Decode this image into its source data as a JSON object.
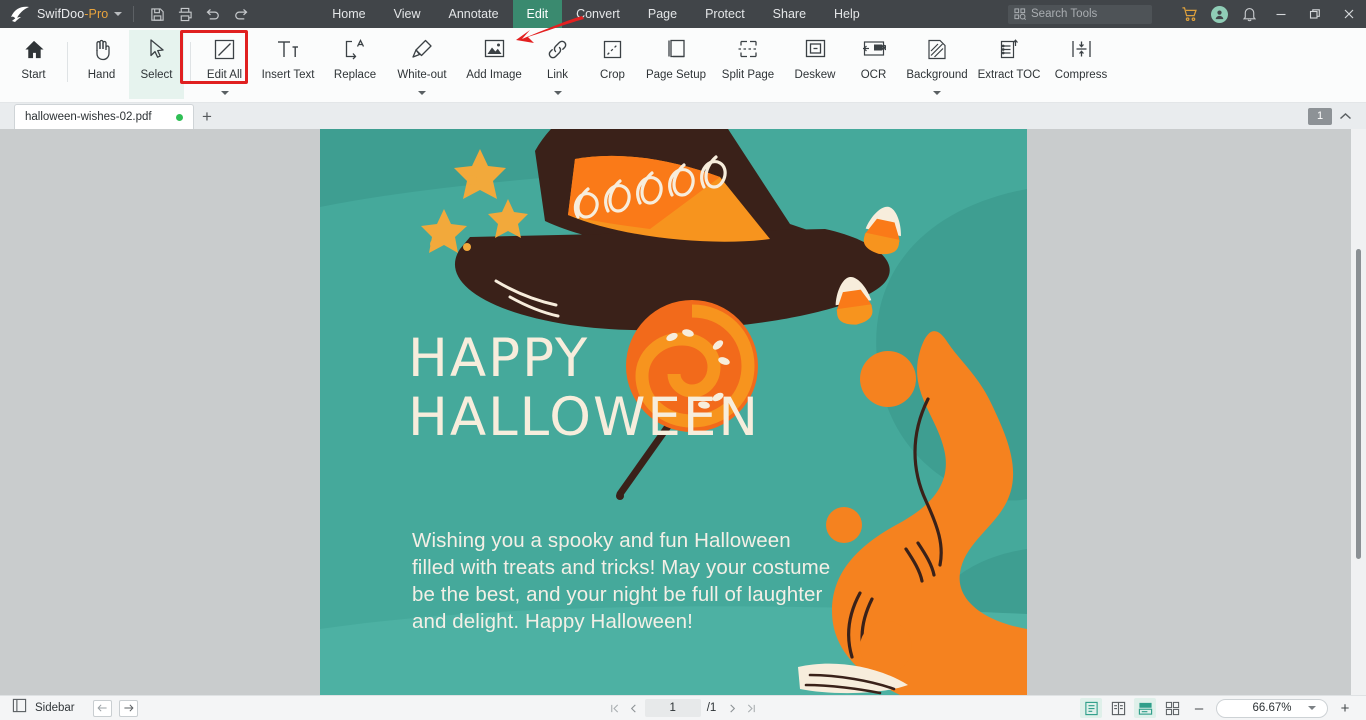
{
  "titlebar": {
    "brand": "SwifDoo",
    "brand_suffix": "-Pro",
    "quick_actions": [
      {
        "name": "save-icon",
        "label": "Save"
      },
      {
        "name": "print-icon",
        "label": "Print"
      },
      {
        "name": "undo-icon",
        "label": "Undo"
      },
      {
        "name": "redo-icon",
        "label": "Redo"
      }
    ],
    "menus": [
      {
        "label": "Home",
        "active": false
      },
      {
        "label": "View",
        "active": false
      },
      {
        "label": "Annotate",
        "active": false
      },
      {
        "label": "Edit",
        "active": true
      },
      {
        "label": "Convert",
        "active": false
      },
      {
        "label": "Page",
        "active": false
      },
      {
        "label": "Protect",
        "active": false
      },
      {
        "label": "Share",
        "active": false
      },
      {
        "label": "Help",
        "active": false
      }
    ],
    "search_placeholder": "Search Tools",
    "right_icons": [
      {
        "name": "cart-icon",
        "label": "Store"
      },
      {
        "name": "account-icon",
        "label": "Account"
      },
      {
        "name": "bell-icon",
        "label": "Notifications"
      }
    ],
    "window_buttons": [
      {
        "name": "minimize-button",
        "label": "Minimize"
      },
      {
        "name": "restore-button",
        "label": "Restore"
      },
      {
        "name": "close-button",
        "label": "Close"
      }
    ],
    "accent_active": "#3a8a6f",
    "background": "#414549"
  },
  "ribbon": {
    "items": [
      {
        "label": "Start",
        "icon": "home-icon",
        "selected": false,
        "caret": false,
        "width": "normal"
      },
      {
        "label": "Hand",
        "icon": "hand-icon",
        "selected": false,
        "caret": false,
        "width": "normal"
      },
      {
        "label": "Select",
        "icon": "cursor-icon",
        "selected": true,
        "caret": false,
        "width": "normal"
      },
      {
        "label": "Edit All",
        "icon": "edit-all-icon",
        "selected": false,
        "caret": true,
        "width": "normal"
      },
      {
        "label": "Insert Text",
        "icon": "insert-text-icon",
        "selected": false,
        "caret": false,
        "width": "wider"
      },
      {
        "label": "Replace",
        "icon": "replace-icon",
        "selected": false,
        "caret": false,
        "width": "wide"
      },
      {
        "label": "White-out",
        "icon": "whiteout-icon",
        "selected": false,
        "caret": true,
        "width": "wider"
      },
      {
        "label": "Add Image",
        "icon": "add-image-icon",
        "selected": false,
        "caret": false,
        "width": "wider"
      },
      {
        "label": "Link",
        "icon": "link-icon",
        "selected": false,
        "caret": true,
        "width": "normal"
      },
      {
        "label": "Crop",
        "icon": "crop-icon",
        "selected": false,
        "caret": false,
        "width": "normal"
      },
      {
        "label": "Page Setup",
        "icon": "page-setup-icon",
        "selected": false,
        "caret": false,
        "width": "wider"
      },
      {
        "label": "Split Page",
        "icon": "split-page-icon",
        "selected": false,
        "caret": false,
        "width": "wider"
      },
      {
        "label": "Deskew",
        "icon": "deskew-icon",
        "selected": false,
        "caret": false,
        "width": "wide"
      },
      {
        "label": "OCR",
        "icon": "ocr-icon",
        "selected": false,
        "caret": false,
        "width": "normal"
      },
      {
        "label": "Background",
        "icon": "background-icon",
        "selected": false,
        "caret": true,
        "width": "wider"
      },
      {
        "label": "Extract TOC",
        "icon": "extract-toc-icon",
        "selected": false,
        "caret": false,
        "width": "wider"
      },
      {
        "label": "Compress",
        "icon": "compress-icon",
        "selected": false,
        "caret": false,
        "width": "wider"
      }
    ],
    "highlight_color": "#e6f3ee"
  },
  "annotation": {
    "rect_color": "#e02020",
    "arrow_color": "#e32020",
    "target_label": "Edit All"
  },
  "tabstrip": {
    "document_name": "halloween-wishes-02.pdf",
    "modified_dot": true,
    "new_tab_label": "+",
    "page_badge": "1",
    "collapse_icon": "chevron-up-icon"
  },
  "statusbar": {
    "sidebar_label": "Sidebar",
    "nav_back_icon": "arrow-left-icon",
    "nav_forward_icon": "arrow-right-icon",
    "page_current": "1",
    "page_total": "/1",
    "first_page_icon": "first-page-icon",
    "prev_page_icon": "prev-page-icon",
    "next_page_icon": "next-page-icon",
    "last_page_icon": "last-page-icon",
    "view_modes": [
      {
        "name": "single-page-view-icon",
        "active": true
      },
      {
        "name": "two-page-view-icon",
        "active": false
      },
      {
        "name": "continuous-scroll-view-icon",
        "active": true
      },
      {
        "name": "thumbnail-grid-view-icon",
        "active": false
      }
    ],
    "zoom_out_label": "–",
    "zoom_value": "66.67%",
    "zoom_in_label": "+"
  },
  "document": {
    "title_line1": "HAPPY",
    "title_line2": "HALLOWEEN",
    "body": "Wishing you a spooky and fun Halloween  filled with treats and tricks! May your costume be the best, and your night be full of laughter and delight. Happy Halloween!",
    "colors": {
      "teal": "#45a99b",
      "teal_dark": "#3e9e91",
      "teal_light": "#5bb6a8",
      "orange": "#f58220",
      "orange_light": "#f7941e",
      "brown": "#3a2119",
      "cream": "#f7eddc",
      "gold": "#f2a93b"
    }
  }
}
